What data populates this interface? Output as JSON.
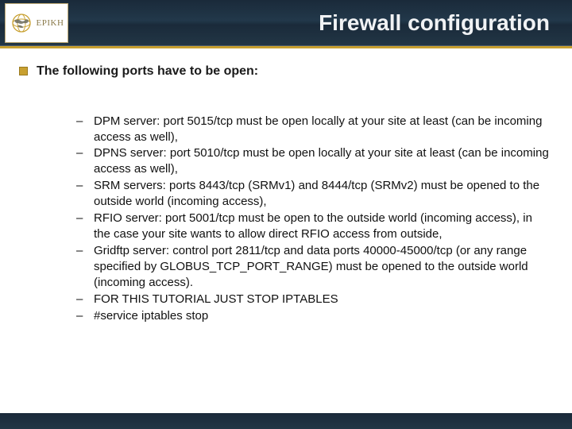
{
  "logo": {
    "text": "EPIKH"
  },
  "header": {
    "title": "Firewall configuration"
  },
  "main_bullet": "The following ports have to be open:",
  "ports": [
    "DPM server: port 5015/tcp must be open locally at your site at least (can be incoming access as well),",
    "DPNS server: port 5010/tcp must be open locally at your site at least (can be incoming access as well),",
    "SRM servers: ports 8443/tcp (SRMv1) and 8444/tcp (SRMv2) must be opened to the outside world (incoming access),",
    "RFIO server: port 5001/tcp must be open to the outside world (incoming access), in the case your site wants to allow direct RFIO access from outside,",
    "Gridftp server: control port 2811/tcp and data ports 40000-45000/tcp (or any range specified by GLOBUS_TCP_PORT_RANGE) must be opened to the outside world (incoming access).",
    "FOR THIS TUTORIAL JUST STOP IPTABLES",
    "#service iptables stop"
  ]
}
